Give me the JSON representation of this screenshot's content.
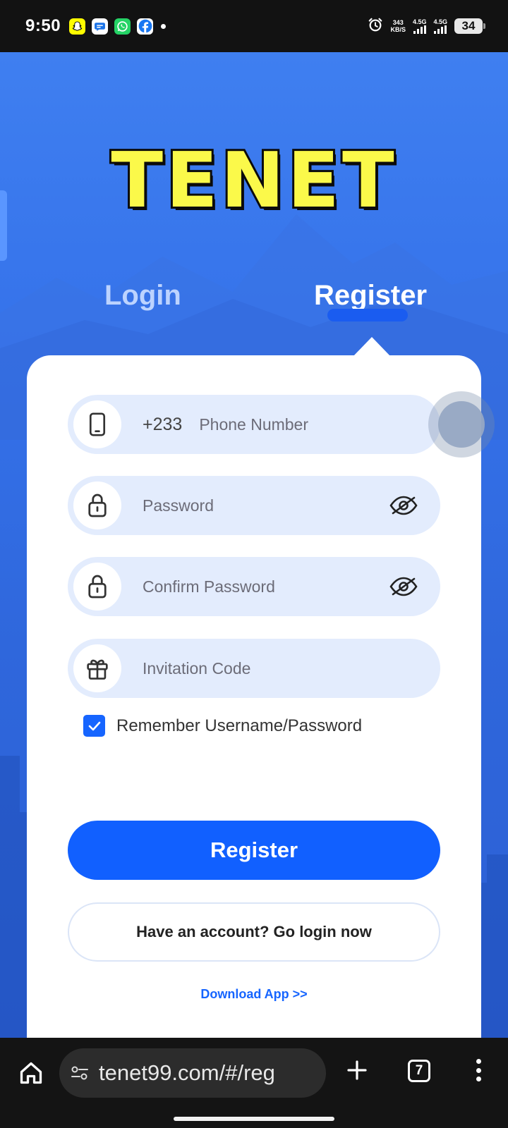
{
  "status_bar": {
    "time": "9:50",
    "notification_icons": [
      "snapchat-icon",
      "chat-icon",
      "whatsapp-icon",
      "facebook-icon"
    ],
    "net_speed_value": "343",
    "net_speed_unit": "KB/S",
    "signal1_label": "4.5G",
    "signal2_label": "4.5G",
    "battery": "34"
  },
  "app": {
    "logo": "TENET",
    "tabs": {
      "login": "Login",
      "register": "Register",
      "active": "register"
    },
    "form": {
      "phone_prefix": "+233",
      "phone_placeholder": "Phone Number",
      "password_placeholder": "Password",
      "confirm_placeholder": "Confirm Password",
      "invitation_placeholder": "Invitation Code",
      "remember_label": "Remember Username/Password",
      "remember_checked": true,
      "register_button": "Register",
      "login_button": "Have an account? Go login now",
      "download_link": "Download App >>"
    },
    "colors": {
      "primary": "#1160ff",
      "background": "#3572ea",
      "logo_fill": "#fbf94a",
      "field_bg": "#e3ecfd"
    }
  },
  "browser": {
    "url": "tenet99.com/#/reg",
    "tab_count": "7"
  }
}
